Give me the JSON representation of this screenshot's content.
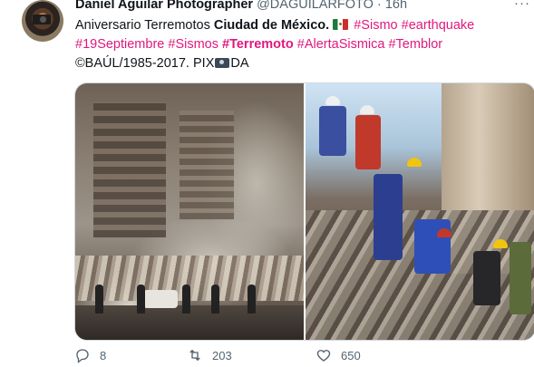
{
  "tweet": {
    "author_name": "Daniel Aguilar Photographer",
    "handle": "@DAGUILARFOTO",
    "separator": "·",
    "time": "16h",
    "more": "···",
    "text_plain_1": "Aniversario Terremotos ",
    "text_bold_1": "Ciudad de México.",
    "hashtag_sismo": "#Sismo",
    "hashtag_earthquake": "#earthquake",
    "hashtag_19sep": "#19Septiembre",
    "hashtag_sismos": "#Sismos",
    "hashtag_terremoto": "#Terremoto",
    "hashtag_alerta": "#AlertaSismica",
    "hashtag_temblor": "#Temblor",
    "credit_1": "©BAÚL/1985-2017. PIX",
    "credit_2": "DA"
  },
  "actions": {
    "reply_count": "8",
    "retweet_count": "203",
    "like_count": "650"
  },
  "icons": {
    "avatar": "avatar-photographer",
    "flag": "mexico-flag-icon",
    "camera": "camera-icon",
    "reply": "reply-icon",
    "retweet": "retweet-icon",
    "like": "heart-icon",
    "more": "more-icon"
  },
  "colors": {
    "hashtag": "#e0187e",
    "secondary_text": "#536471",
    "primary_text": "#0f1419"
  }
}
